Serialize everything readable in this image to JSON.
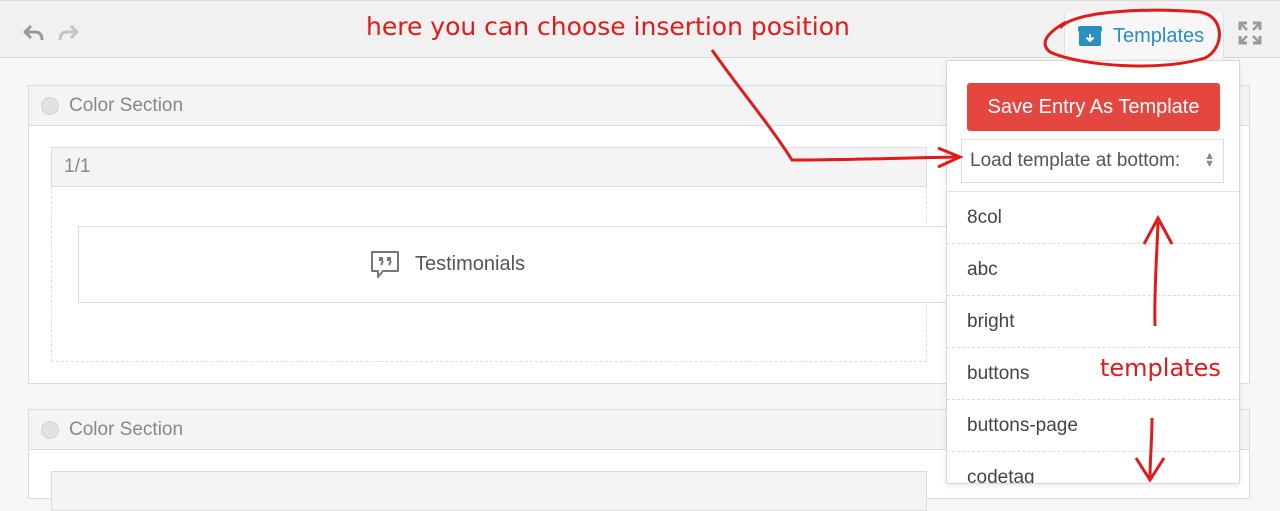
{
  "toolbar": {
    "templates_label": "Templates"
  },
  "annotations": {
    "top": "here you can choose insertion position",
    "side": "templates"
  },
  "sections": [
    {
      "title": "Color Section",
      "column_label": "1/1",
      "element_label": "Testimonials"
    },
    {
      "title": "Color Section"
    }
  ],
  "templates_menu": {
    "save_label": "Save Entry As Template",
    "position_select": "Load template at bottom:",
    "items": [
      "8col",
      "abc",
      "bright",
      "buttons",
      "buttons-page",
      "codetag"
    ]
  },
  "colors": {
    "accent": "#2d8ec2",
    "save_button": "#e4473f",
    "annotation": "#e11a1a"
  }
}
